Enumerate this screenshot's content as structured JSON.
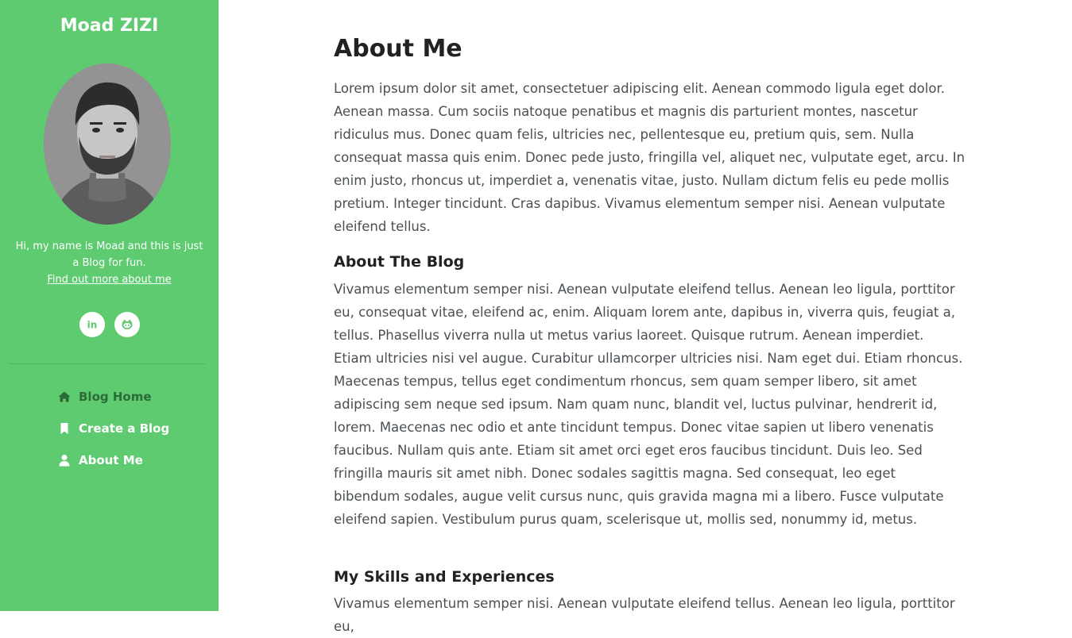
{
  "sidebar": {
    "title": "Moad ZIZI",
    "bio": "Hi, my name is Moad and this is just a Blog for fun.",
    "bio_link": "Find out more about me",
    "socials": [
      {
        "name": "linkedin",
        "icon": "linkedin-icon"
      },
      {
        "name": "github",
        "icon": "github-icon"
      }
    ],
    "nav": [
      {
        "label": "Blog Home",
        "icon": "home-icon",
        "active": true
      },
      {
        "label": "Create a Blog",
        "icon": "bookmark-icon",
        "active": false
      },
      {
        "label": "About Me",
        "icon": "user-icon",
        "active": false
      }
    ],
    "colors": {
      "background": "#5fcb71",
      "active_nav": "#2c6b37"
    }
  },
  "main": {
    "title": "About Me",
    "intro": "Lorem ipsum dolor sit amet, consectetuer adipiscing elit. Aenean commodo ligula eget dolor. Aenean massa. Cum sociis natoque penatibus et magnis dis parturient montes, nascetur ridiculus mus. Donec quam felis, ultricies nec, pellentesque eu, pretium quis, sem. Nulla consequat massa quis enim. Donec pede justo, fringilla vel, aliquet nec, vulputate eget, arcu. In enim justo, rhoncus ut, imperdiet a, venenatis vitae, justo. Nullam dictum felis eu pede mollis pretium. Integer tincidunt. Cras dapibus. Vivamus elementum semper nisi. Aenean vulputate eleifend tellus.",
    "sections": [
      {
        "heading": "About The Blog",
        "body": "Vivamus elementum semper nisi. Aenean vulputate eleifend tellus. Aenean leo ligula, porttitor eu, consequat vitae, eleifend ac, enim. Aliquam lorem ante, dapibus in, viverra quis, feugiat a, tellus. Phasellus viverra nulla ut metus varius laoreet. Quisque rutrum. Aenean imperdiet. Etiam ultricies nisi vel augue. Curabitur ullamcorper ultricies nisi. Nam eget dui. Etiam rhoncus. Maecenas tempus, tellus eget condimentum rhoncus, sem quam semper libero, sit amet adipiscing sem neque sed ipsum. Nam quam nunc, blandit vel, luctus pulvinar, hendrerit id, lorem. Maecenas nec odio et ante tincidunt tempus. Donec vitae sapien ut libero venenatis faucibus. Nullam quis ante. Etiam sit amet orci eget eros faucibus tincidunt. Duis leo. Sed fringilla mauris sit amet nibh. Donec sodales sagittis magna. Sed consequat, leo eget bibendum sodales, augue velit cursus nunc, quis gravida magna mi a libero. Fusce vulputate eleifend sapien. Vestibulum purus quam, scelerisque ut, mollis sed, nonummy id, metus."
      },
      {
        "heading": "My Skills and Experiences",
        "body": "Vivamus elementum semper nisi. Aenean vulputate eleifend tellus. Aenean leo ligula, porttitor eu,"
      }
    ]
  }
}
